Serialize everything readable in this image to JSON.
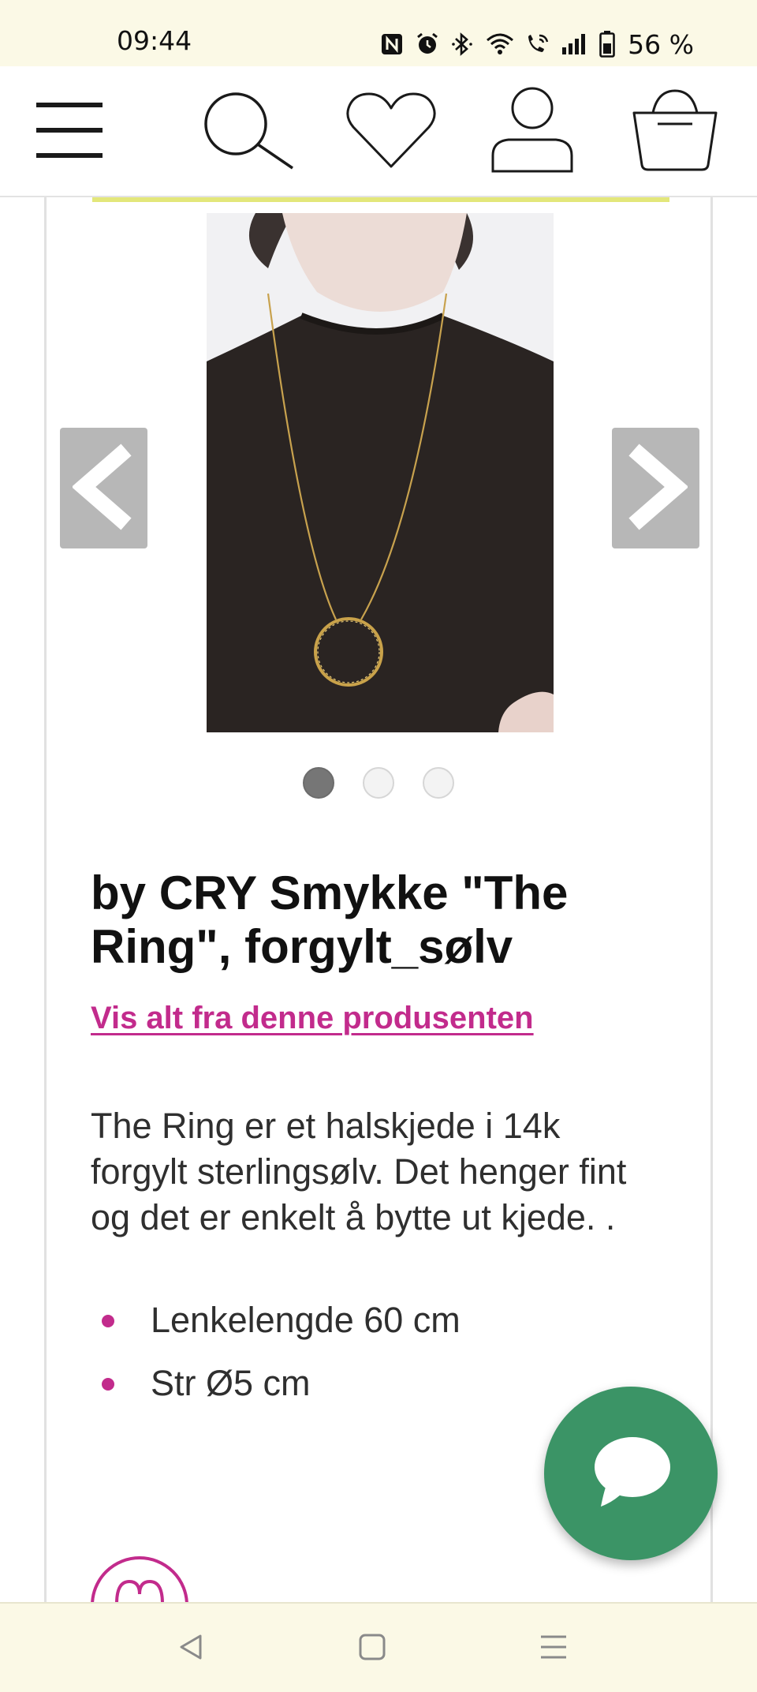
{
  "status_bar": {
    "time": "09:44",
    "battery": "56 %",
    "icons": [
      "nfc-icon",
      "alarm-icon",
      "bluetooth-icon",
      "wifi-icon",
      "wifi-call-icon",
      "signal-icon",
      "battery-icon"
    ]
  },
  "header": {
    "icons": [
      "menu-icon",
      "search-icon",
      "heart-icon",
      "account-icon",
      "basket-icon"
    ]
  },
  "gallery": {
    "image_count": 3,
    "active_index": 0
  },
  "product": {
    "title": "by CRY Smykke \"The Ring\", forgylt_sølv",
    "brand_link": "Vis alt fra denne produsenten",
    "description": "The Ring er et halskjede i 14k forgylt sterlingsølv. Det henger fint og det er enkelt å bytte ut kjede. .",
    "features": [
      "Lenkelengde 60 cm",
      "Str Ø5 cm"
    ]
  },
  "colors": {
    "accent_pink": "#c22b8c",
    "chat_green": "#3b9466",
    "highlight_yellow": "#e3e77a",
    "system_bar": "#fbf9e6"
  },
  "nav_bar": {
    "icons": [
      "back-icon",
      "home-icon",
      "recents-icon"
    ]
  }
}
